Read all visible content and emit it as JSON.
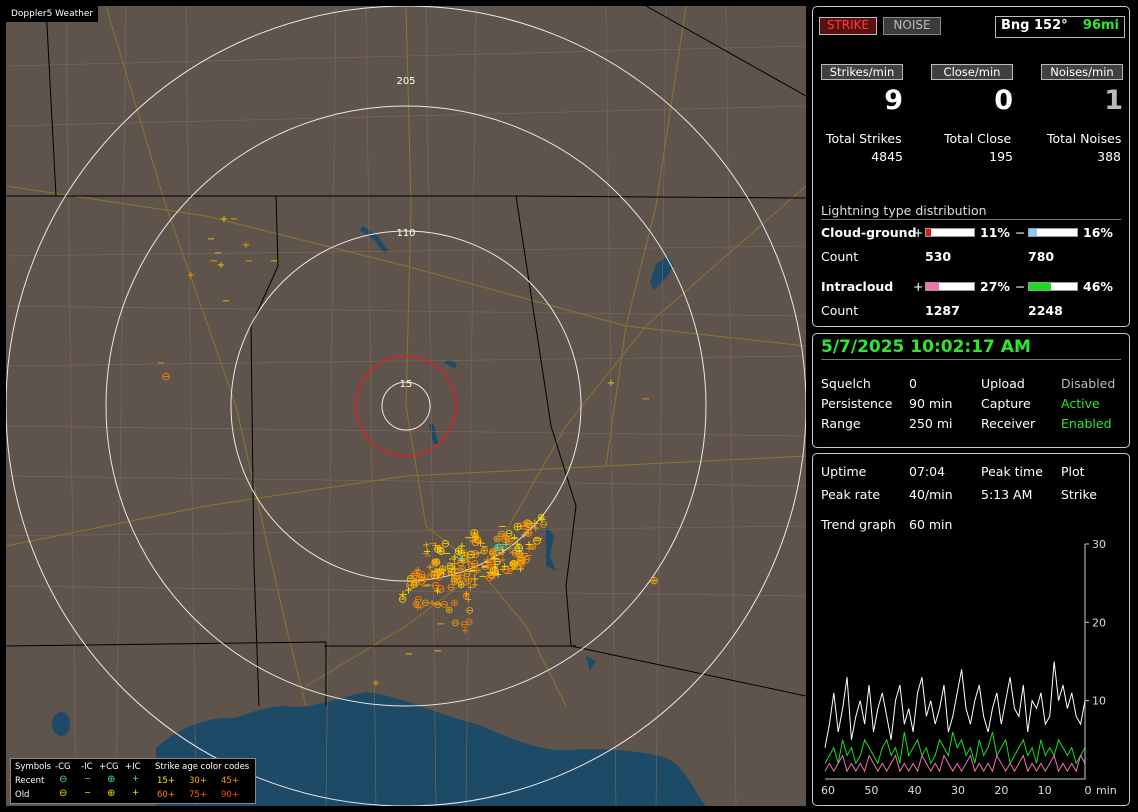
{
  "map": {
    "title": "Doppler5 Weather",
    "range_labels": [
      "205",
      "110",
      "15"
    ],
    "legend": {
      "symbols_label": "Symbols",
      "cols": [
        "-CG",
        "-IC",
        "+CG",
        "+IC"
      ],
      "age_title": "Strike age color codes",
      "recent_label": "Recent",
      "old_label": "Old",
      "recent_ages": [
        "15+",
        "30+",
        "45+"
      ],
      "old_ages": [
        "60+",
        "75+",
        "90+"
      ]
    }
  },
  "status": {
    "strike_btn": "STRIKE",
    "noise_btn": "NOISE",
    "bearing": "Bng 152°",
    "distance": "96mi",
    "headers": [
      "Strikes/min",
      "Close/min",
      "Noises/min"
    ],
    "rates": [
      "9",
      "0",
      "1"
    ],
    "totals_labels": [
      "Total Strikes",
      "Total Close",
      "Total Noises"
    ],
    "totals_values": [
      "4845",
      "195",
      "388"
    ],
    "dist_title": "Lightning type distribution",
    "cg_label": "Cloud-ground",
    "ic_label": "Intracloud",
    "count_label": "Count",
    "plus": "+",
    "minus": "−",
    "cg_pos_pct": "11%",
    "cg_neg_pct": "16%",
    "ic_pos_pct": "27%",
    "ic_neg_pct": "46%",
    "cg_pos_count": "530",
    "cg_neg_count": "780",
    "ic_pos_count": "1287",
    "ic_neg_count": "2248",
    "cg_pos_frac": 0.11,
    "cg_neg_frac": 0.16,
    "ic_pos_frac": 0.27,
    "ic_neg_frac": 0.46,
    "colors": {
      "cg_pos": "#e01818",
      "cg_neg": "#8ac8f0",
      "ic_pos": "#f070b0",
      "ic_neg": "#18e018"
    }
  },
  "info": {
    "datetime": "5/7/2025 10:02:17 AM",
    "rows": [
      {
        "k1": "Squelch",
        "v1": "0",
        "k2": "Upload",
        "v2": "Disabled"
      },
      {
        "k1": "Persistence",
        "v1": "90 min",
        "k2": "Capture",
        "v2": "Active"
      },
      {
        "k1": "Range",
        "v1": "250 mi",
        "k2": "Receiver",
        "v2": "Enabled"
      }
    ]
  },
  "stats": {
    "uptime_label": "Uptime",
    "uptime": "07:04",
    "peak_time_label": "Peak time",
    "peak_time": "5:13 AM",
    "plot_label": "Plot",
    "plot_value": "Strike",
    "peak_rate_label": "Peak rate",
    "peak_rate": "40/min",
    "trend_label": "Trend graph",
    "trend_value": "60 min"
  },
  "chart_data": {
    "type": "line",
    "x_ticks": [
      "60",
      "50",
      "40",
      "30",
      "20",
      "10",
      "0"
    ],
    "x_unit": "min",
    "y_ticks": [
      "30",
      "20",
      "10"
    ],
    "ylim": [
      0,
      30
    ],
    "xlim": [
      60,
      0
    ],
    "series": [
      {
        "color": "#ffffff",
        "values": [
          4,
          7,
          11,
          6,
          9,
          13,
          5,
          8,
          10,
          7,
          12,
          6,
          9,
          11,
          8,
          5,
          10,
          12,
          7,
          9,
          6,
          11,
          13,
          8,
          10,
          7,
          9,
          12,
          6,
          8,
          11,
          14,
          9,
          7,
          10,
          12,
          8,
          6,
          9,
          11,
          7,
          10,
          13,
          9,
          8,
          12,
          6,
          10,
          9,
          11,
          7,
          8,
          15,
          10,
          12,
          9,
          11,
          8,
          7,
          10
        ]
      },
      {
        "color": "#18e018",
        "values": [
          2,
          3,
          4,
          2,
          5,
          3,
          4,
          2,
          3,
          5,
          4,
          3,
          2,
          4,
          5,
          3,
          4,
          2,
          6,
          3,
          4,
          5,
          3,
          4,
          2,
          3,
          5,
          4,
          3,
          6,
          4,
          5,
          3,
          4,
          2,
          5,
          3,
          4,
          6,
          3,
          4,
          5,
          2,
          3,
          4,
          5,
          3,
          4,
          2,
          5,
          3,
          4,
          3,
          5,
          4,
          3,
          4,
          2,
          3,
          4
        ]
      },
      {
        "color": "#f070b0",
        "values": [
          1,
          2,
          1,
          2,
          3,
          1,
          2,
          1,
          2,
          1,
          3,
          2,
          1,
          2,
          1,
          2,
          3,
          1,
          2,
          1,
          2,
          1,
          3,
          2,
          1,
          2,
          1,
          3,
          2,
          1,
          2,
          1,
          2,
          3,
          1,
          2,
          1,
          2,
          1,
          3,
          2,
          1,
          2,
          1,
          2,
          3,
          1,
          2,
          1,
          2,
          1,
          2,
          3,
          1,
          2,
          1,
          2,
          1,
          3,
          2
        ]
      }
    ]
  }
}
